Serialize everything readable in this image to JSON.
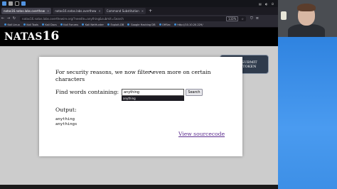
{
  "browser": {
    "tabs": [
      {
        "label": "natas16.natas.labs.overthew",
        "active": true
      },
      {
        "label": "natas16.natas.labs.overthew",
        "active": false
      },
      {
        "label": "Command Substitution",
        "active": false
      }
    ],
    "url": "natas16.natas.labs.overthewire.org/?needle=anything&submit=Search",
    "zoom": "133%",
    "bookmarks": [
      "Kali Linux",
      "Kali Tools",
      "Kali Docs",
      "Kali Forums",
      "Kali NetHunter",
      "Exploit-DB",
      "Google Hacking DB",
      "OffSec",
      "http://10.10.20.229/"
    ]
  },
  "page": {
    "brand": "NATAS",
    "level": "16",
    "message": "For security reasons, we now filter even more on certain characters",
    "find_label": "Find words containing:",
    "search_value": "anything",
    "search_button": "Search",
    "autocomplete": "anything",
    "output_label": "Output:",
    "output_lines": "anything\nanythings",
    "view_source": "View sourcecode",
    "submit_token": {
      "line1": "SUBMIT",
      "line2": "TOKEN",
      "badge": "WeChall"
    }
  },
  "colors": {
    "header_bg": "#000000",
    "page_bg": "#cccccc",
    "link": "#5b2c8e",
    "desktop_blue": "#3d8fe6"
  }
}
